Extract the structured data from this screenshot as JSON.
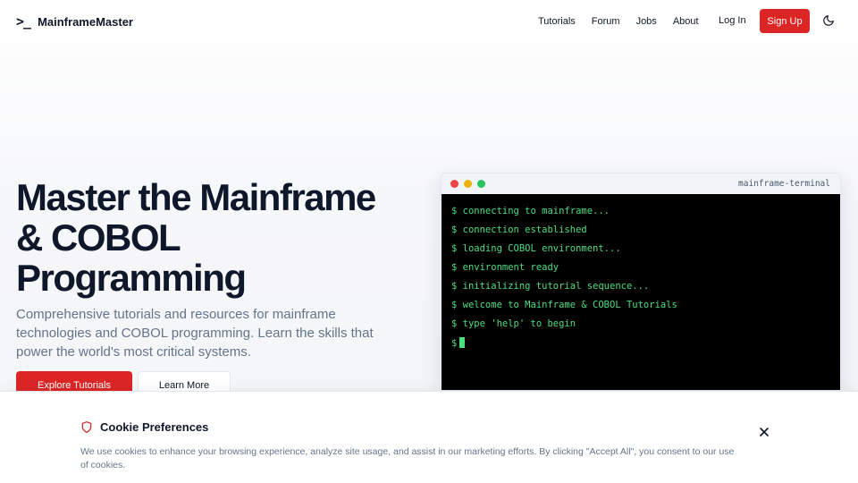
{
  "header": {
    "brand_icon": ">_",
    "brand_name": "MainframeMaster",
    "nav": [
      "Tutorials",
      "Forum",
      "Jobs",
      "About"
    ],
    "login": "Log In",
    "signup": "Sign Up",
    "theme_icon": "moon-icon",
    "accent": "#dc2626"
  },
  "hero": {
    "title": "Master the Mainframe & COBOL Programming",
    "subtitle": "Comprehensive tutorials and resources for mainframe technologies and COBOL programming. Learn the skills that power the world's most critical systems.",
    "primary_button": "Explore Tutorials",
    "secondary_button": "Learn More"
  },
  "terminal": {
    "title": "mainframe-terminal",
    "lines": [
      "$ connecting to mainframe...",
      "$ connection established",
      "$ loading COBOL environment...",
      "$ environment ready",
      "$ initializing tutorial sequence...",
      "$ welcome to Mainframe & COBOL Tutorials",
      "$ type 'help' to begin"
    ],
    "prompt": "$",
    "text_color": "#4ade80",
    "dot_colors": [
      "#ef4444",
      "#eab308",
      "#22c55e"
    ]
  },
  "cookie": {
    "icon": "shield-icon",
    "title": "Cookie Preferences",
    "text": "We use cookies to enhance your browsing experience, analyze site usage, and assist in our marketing efforts. By clicking \"Accept All\", you consent to our use of cookies.",
    "close_icon": "close-icon"
  }
}
